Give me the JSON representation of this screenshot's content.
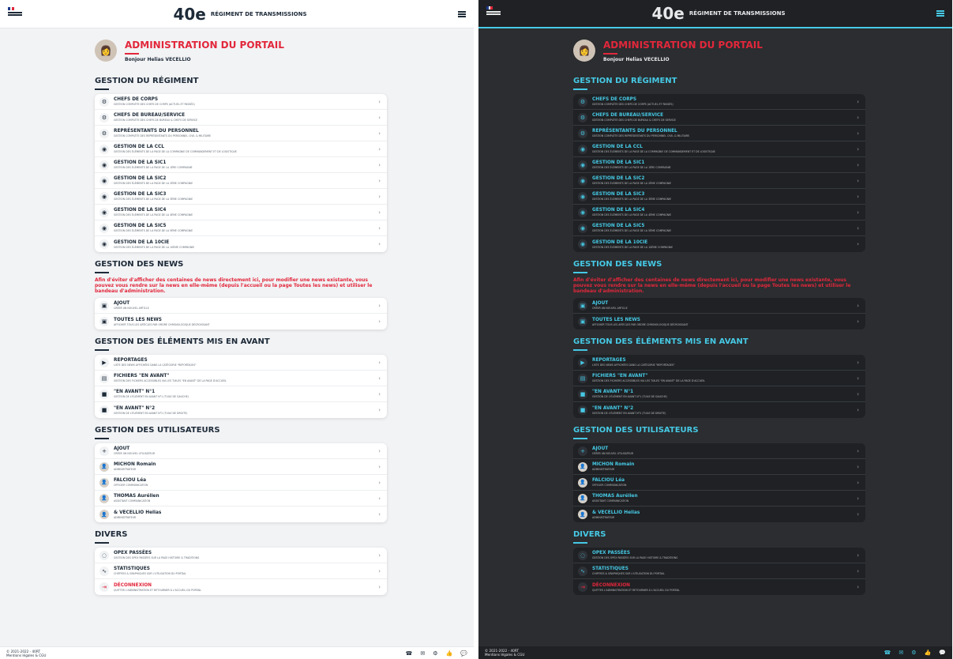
{
  "title": "ADMINISTRATION DU PORTAIL",
  "greeting": "Bonjour Helias VECELLIO",
  "brand": {
    "number": "40e",
    "subtitle": "RÉGIMENT DE TRANSMISSIONS"
  },
  "sections": {
    "regiment": {
      "title": "GESTION DU RÉGIMENT",
      "items": [
        {
          "label": "CHEFS DE CORPS",
          "desc": "GESTION COMPLÈTE DES CHEFS DE CORPS (ACTUEL ET PASSÉS)"
        },
        {
          "label": "CHEFS DE BUREAU/SERVICE",
          "desc": "GESTION COMPLÈTE DES CHEFS DE BUREAU & CHEFS DE SERVICE"
        },
        {
          "label": "REPRÉSENTANTS DU PERSONNEL",
          "desc": "GESTION COMPLÈTE DES REPRÉSENTANTS DU PERSONNEL CIVIL & MILITAIRE"
        },
        {
          "label": "GESTION DE LA CCL",
          "desc": "GESTION DES ÉLÉMENTS DE LA PAGE DE LA COMPAGNIE DE COMMANDEMENT ET DE LOGISTIQUE"
        },
        {
          "label": "GESTION DE LA SIC1",
          "desc": "GESTION DES ÉLÉMENTS DE LA PAGE DE LA 1ÈRE COMPAGNIE"
        },
        {
          "label": "GESTION DE LA SIC2",
          "desc": "GESTION DES ÉLÉMENTS DE LA PAGE DE LA 2ÈME COMPAGNIE"
        },
        {
          "label": "GESTION DE LA SIC3",
          "desc": "GESTION DES ÉLÉMENTS DE LA PAGE DE LA 3ÈME COMPAGNIE"
        },
        {
          "label": "GESTION DE LA SIC4",
          "desc": "GESTION DES ÉLÉMENTS DE LA PAGE DE LA 4ÈME COMPAGNIE"
        },
        {
          "label": "GESTION DE LA SIC5",
          "desc": "GESTION DES ÉLÉMENTS DE LA PAGE DE LA 5ÈME COMPAGNIE"
        },
        {
          "label": "GESTION DE LA 10CIE",
          "desc": "GESTION DES ÉLÉMENTS DE LA PAGE DE LA 10ÈME COMPAGNIE"
        }
      ]
    },
    "news": {
      "title": "GESTION DES NEWS",
      "notice": "Afin d'éviter d'afficher des centaines de news directement ici, pour modifier une news existante, vous pouvez vous rendre sur la news en elle-même (depuis l'accueil ou la page Toutes les news) et utiliser le bandeau d'administration.",
      "items": [
        {
          "label": "AJOUT",
          "desc": "CRÉER UN NOUVEL ARTICLE"
        },
        {
          "label": "TOUTES LES NEWS",
          "desc": "AFFICHER TOUS LES ARTICLES PAR ORDRE CHRONOLOGIQUE DÉCROISSANT"
        }
      ]
    },
    "highlight": {
      "title": "GESTION DES ÉLÉMENTS MIS EN AVANT",
      "items": [
        {
          "label": "REPORTAGES",
          "desc": "LISTE DES NEWS AFFICHÉES DANS LA CATÉGORIE \"REPORTAGES\""
        },
        {
          "label": "FICHIERS \"EN AVANT\"",
          "desc": "GESTION DES FICHIERS ACCESSIBLES VIA LES TUILES \"EN AVANT\" DE LA PAGE D'ACCUEIL"
        },
        {
          "label": "\"EN AVANT\" N°1",
          "desc": "GESTION DE L'ÉLÉMENT EN AVANT N°1 (TUILE DE GAUCHE)"
        },
        {
          "label": "\"EN AVANT\" N°2",
          "desc": "GESTION DE L'ÉLÉMENT EN AVANT N°2 (TUILE DE DROITE)"
        }
      ]
    },
    "users": {
      "title": "GESTION DES UTILISATEURS",
      "items": [
        {
          "label": "AJOUT",
          "desc": "CRÉER UN NOUVEL UTILISATEUR"
        },
        {
          "label": "MICHON Romain",
          "desc": "ADMINISTRATEUR"
        },
        {
          "label": "FALCIOU Léa",
          "desc": "OFFICIER COMMUNICATION"
        },
        {
          "label": "THOMAS Aurélien",
          "desc": "ASSISTANT COMMUNICATION"
        },
        {
          "label": "& VECELLIO Helias",
          "desc": "ADMINISTRATEUR"
        }
      ]
    },
    "divers": {
      "title": "DIVERS",
      "items": [
        {
          "label": "OPEX PASSÉES",
          "desc": "GESTION DES OPEX PASSÉES SUR LA PAGE HISTOIRE & TRADITIONS"
        },
        {
          "label": "STATISTIQUES",
          "desc": "CHIFFRES & GRAPHIQUES SUR L'UTILISATION DU PORTAIL"
        },
        {
          "label": "DÉCONNEXION",
          "desc": "QUITTER L'ADMINISTRATION ET RETOURNER À L'ACCUEIL DU PORTAIL"
        }
      ]
    }
  },
  "footer": {
    "left1": "© 2021-2022 - 40RT",
    "left2": "Mentions légales & CGU"
  },
  "colors": {
    "accent": "#e2273b",
    "cyan": "#46c9e5"
  }
}
